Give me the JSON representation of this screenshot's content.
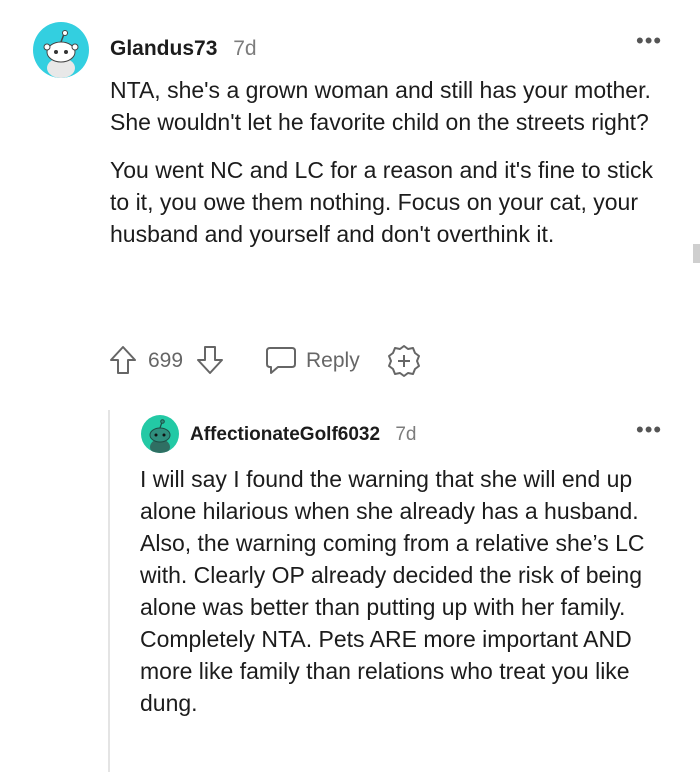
{
  "colors": {
    "avatar1_bg": "#33cfe0",
    "avatar2_bg": "#23c9a5",
    "text": "#1c1c1c",
    "meta": "#7c7c7c"
  },
  "comment": {
    "username": "Glandus73",
    "age": "7d",
    "paragraphs": [
      "NTA, she's a grown woman and still has your mother. She wouldn't let he favorite child on the streets right?",
      "You went NC and LC for a reason and it's fine to stick to it, you owe them nothing. Focus on your cat, your husband and yourself and don't overthink it."
    ],
    "score": "699",
    "reply_label": "Reply",
    "icons": [
      "upvote-icon",
      "downvote-icon",
      "reply-icon",
      "award-icon",
      "more-options-icon"
    ]
  },
  "reply": {
    "username": "AffectionateGolf6032",
    "age": "7d",
    "text": "I will say I found the warning that she will end up alone hilarious when she already has a husband. Also, the warning coming from a relative she’s LC with. Clearly OP already decided the risk of being alone was better than putting up with her family. Completely NTA. Pets ARE more important AND more like family than relations who treat you like dung."
  }
}
